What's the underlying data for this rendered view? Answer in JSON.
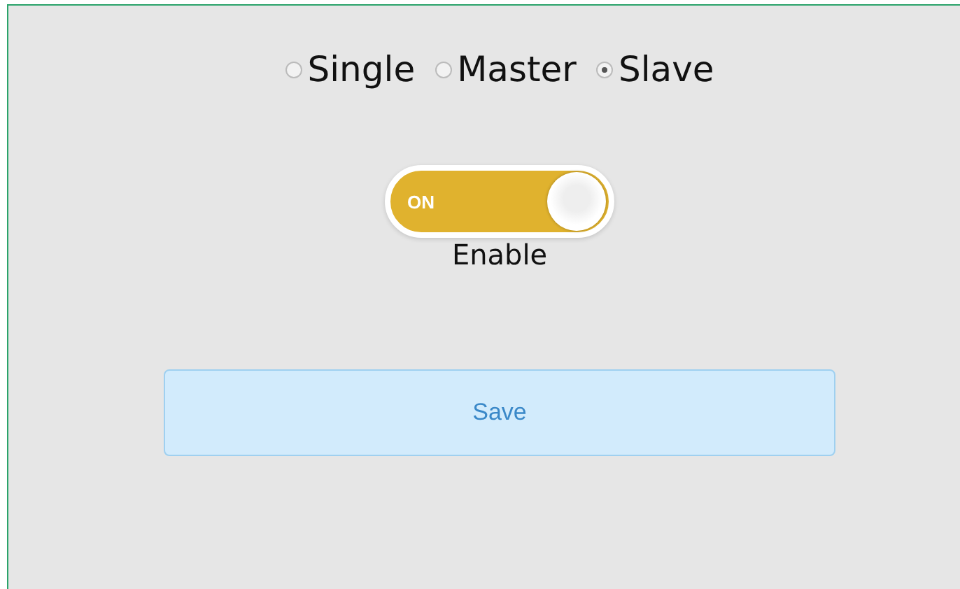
{
  "modes": [
    {
      "label": "Single",
      "selected": false
    },
    {
      "label": "Master",
      "selected": false
    },
    {
      "label": "Slave",
      "selected": true
    }
  ],
  "toggle": {
    "text": "ON",
    "on": true,
    "label": "Enable"
  },
  "buttons": [
    {
      "label": "Save"
    }
  ]
}
